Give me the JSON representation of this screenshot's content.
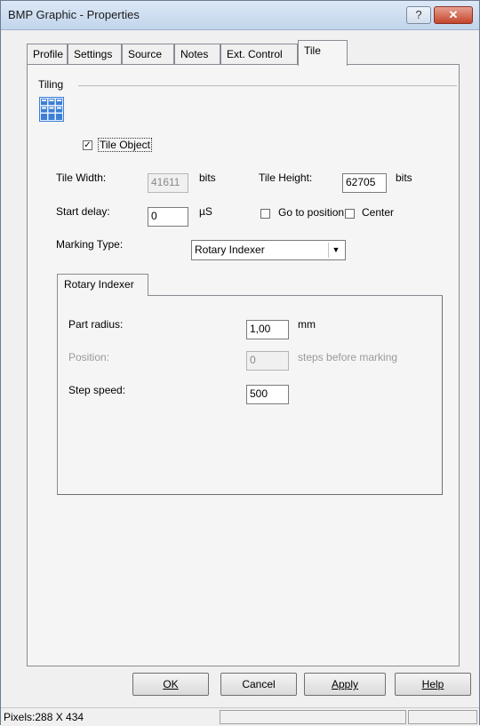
{
  "window": {
    "title": "BMP Graphic - Properties",
    "help_icon": "question-mark-icon",
    "close_icon": "close-x-icon",
    "help_glyph": "?",
    "close_glyph": "✕"
  },
  "tabs": [
    {
      "label": "Profile"
    },
    {
      "label": "Settings"
    },
    {
      "label": "Source"
    },
    {
      "label": "Notes"
    },
    {
      "label": "Ext. Control"
    },
    {
      "label": "Tile",
      "active": true
    }
  ],
  "tiling": {
    "group_label": "Tiling",
    "tile_object_label": "Tile Object",
    "tile_object_checked": true,
    "tile_width_label": "Tile Width:",
    "tile_width_value": "41611",
    "tile_width_unit": "bits",
    "tile_height_label": "Tile Height:",
    "tile_height_value": "62705",
    "tile_height_unit": "bits",
    "start_delay_label": "Start delay:",
    "start_delay_value": "0",
    "start_delay_unit": "µS",
    "go_to_position_label": "Go to position",
    "center_label": "Center",
    "marking_type_label": "Marking Type:",
    "marking_type_value": "Rotary Indexer"
  },
  "rotary": {
    "tab_label": "Rotary Indexer",
    "part_radius_label": "Part radius:",
    "part_radius_value": "1,00",
    "part_radius_unit": "mm",
    "position_label": "Position:",
    "position_value": "0",
    "position_unit": "steps before marking",
    "step_speed_label": "Step speed:",
    "step_speed_value": "500"
  },
  "buttons": {
    "ok": "OK",
    "cancel": "Cancel",
    "apply": "Apply",
    "help": "Help"
  },
  "status": {
    "pixels": "Pixels:288 X 434"
  },
  "colors": {
    "title_bar": "#c2d5ec",
    "close_button": "#c4452c",
    "tile_icon": "#3d7fd6"
  }
}
